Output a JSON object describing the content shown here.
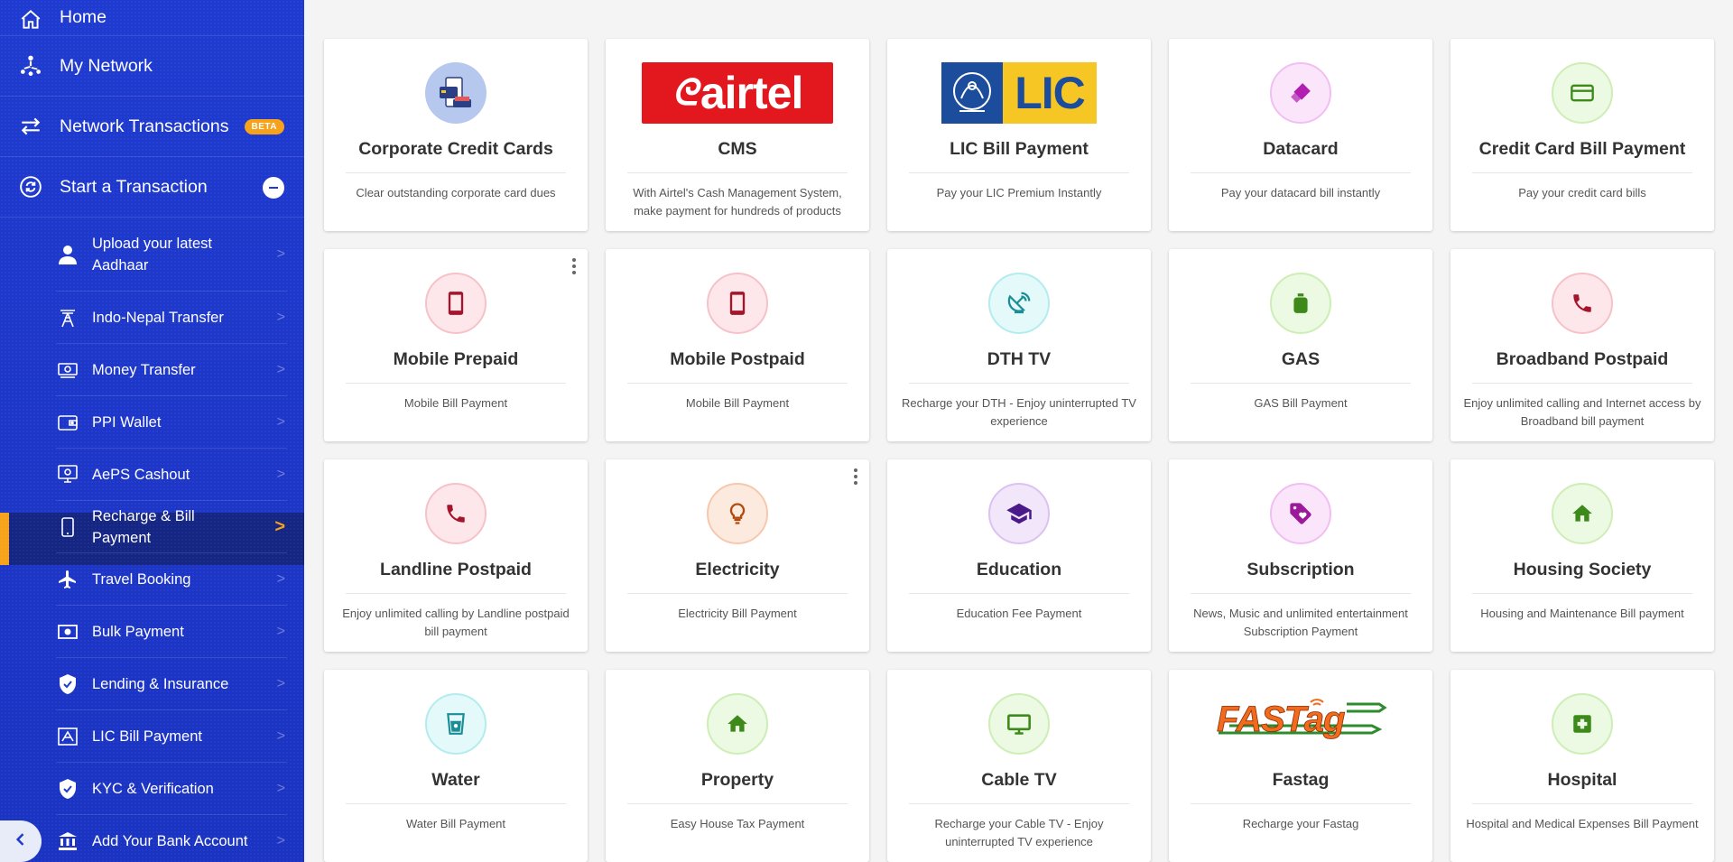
{
  "sidebar": {
    "top_items": [
      {
        "label": "Home",
        "icon": "home-icon"
      },
      {
        "label": "My Network",
        "icon": "network-icon"
      },
      {
        "label": "Network Transactions",
        "icon": "transfer-arrows-icon",
        "badge": "BETA"
      },
      {
        "label": "Start a Transaction",
        "icon": "transaction-cycle-icon"
      }
    ],
    "sub_items": [
      {
        "label": "Upload your latest Aadhaar",
        "icon": "person-icon"
      },
      {
        "label": "Indo-Nepal Transfer",
        "icon": "tower-icon"
      },
      {
        "label": "Money Transfer",
        "icon": "banknote-icon"
      },
      {
        "label": "PPI Wallet",
        "icon": "wallet-icon"
      },
      {
        "label": "AePS Cashout",
        "icon": "fingerprint-device-icon"
      },
      {
        "label": "Recharge & Bill Payment",
        "icon": "mobile-icon",
        "active": true
      },
      {
        "label": "Travel Booking",
        "icon": "airplane-icon"
      },
      {
        "label": "Bulk Payment",
        "icon": "bulk-cash-icon"
      },
      {
        "label": "Lending & Insurance",
        "icon": "shield-check-icon"
      },
      {
        "label": "LIC Bill Payment",
        "icon": "lic-icon"
      },
      {
        "label": "KYC & Verification",
        "icon": "shield-check-icon"
      },
      {
        "label": "Add Your Bank Account",
        "icon": "bank-icon"
      }
    ],
    "colors": {
      "bg": "#1f3ad0",
      "accent": "#f7a21b",
      "active_bg": "#142583"
    }
  },
  "cards": [
    {
      "title": "Corporate Credit Cards",
      "desc": "Clear outstanding corporate card dues",
      "icon": "credit-card-illustration-icon"
    },
    {
      "title": "CMS",
      "desc": "With Airtel's Cash Management System, make payment for hundreds of products",
      "icon": "airtel-logo",
      "logo_text": "airtel"
    },
    {
      "title": "LIC Bill Payment",
      "desc": "Pay your LIC Premium Instantly",
      "icon": "lic-logo",
      "logo_text": "LIC"
    },
    {
      "title": "Datacard",
      "desc": "Pay your datacard bill instantly",
      "icon": "usb-stick-icon"
    },
    {
      "title": "Credit Card Bill Payment",
      "desc": "Pay your credit card bills",
      "icon": "credit-card-icon"
    },
    {
      "title": "Mobile Prepaid",
      "desc": "Mobile Bill Payment",
      "icon": "mobile-phone-icon"
    },
    {
      "title": "Mobile Postpaid",
      "desc": "Mobile Bill Payment",
      "icon": "mobile-phone-icon"
    },
    {
      "title": "DTH TV",
      "desc": "Recharge your DTH - Enjoy uninterrupted TV experience",
      "icon": "satellite-dish-icon"
    },
    {
      "title": "GAS",
      "desc": "GAS Bill Payment",
      "icon": "gas-cylinder-icon"
    },
    {
      "title": "Broadband Postpaid",
      "desc": "Enjoy unlimited calling and Internet access by Broadband bill payment",
      "icon": "phone-handset-icon"
    },
    {
      "title": "Landline Postpaid",
      "desc": "Enjoy unlimited calling by Landline postpaid bill payment",
      "icon": "phone-handset-icon"
    },
    {
      "title": "Electricity",
      "desc": "Electricity Bill Payment",
      "icon": "light-bulb-icon"
    },
    {
      "title": "Education",
      "desc": "Education Fee Payment",
      "icon": "graduation-cap-icon"
    },
    {
      "title": "Subscription",
      "desc": "News, Music and unlimited entertainment Subscription Payment",
      "icon": "tag-heart-icon"
    },
    {
      "title": "Housing Society",
      "desc": "Housing and Maintenance Bill payment",
      "icon": "house-icon"
    },
    {
      "title": "Water",
      "desc": "Water Bill Payment",
      "icon": "water-glass-icon"
    },
    {
      "title": "Property",
      "desc": "Easy House Tax Payment",
      "icon": "house-icon"
    },
    {
      "title": "Cable TV",
      "desc": "Recharge your Cable TV - Enjoy uninterrupted TV experience",
      "icon": "tv-monitor-icon"
    },
    {
      "title": "Fastag",
      "desc": "Recharge your Fastag",
      "icon": "fastag-logo",
      "logo_text": "FASTag"
    },
    {
      "title": "Hospital",
      "desc": "Hospital and Medical Expenses Bill Payment",
      "icon": "medical-cross-icon"
    }
  ]
}
